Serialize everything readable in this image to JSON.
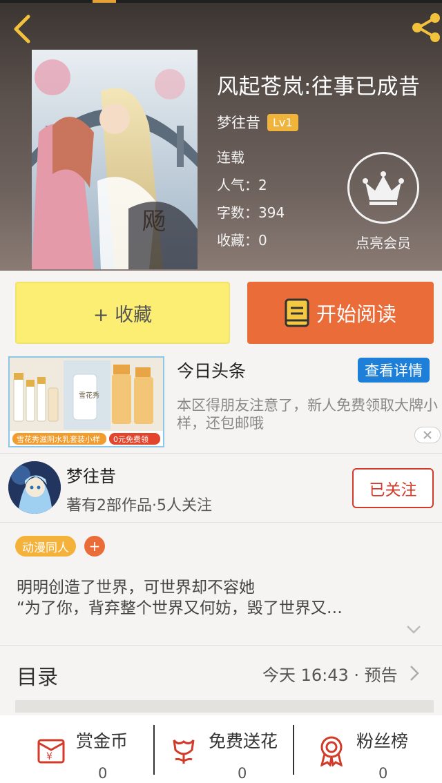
{
  "header": {
    "title": "风起苍岚:往事已成昔",
    "author": "梦往昔",
    "level": "Lv1",
    "status": "连载",
    "popularity": "人气：2",
    "word_count": "字数：394",
    "favorites": "收藏：0",
    "vip_label": "点亮会员"
  },
  "actions": {
    "collect_label": "+ 收藏",
    "read_label": "开始阅读"
  },
  "ad": {
    "title": "今日头条",
    "detail_button": "查看详情",
    "description": "本区得朋友注意了，新人免费领取大牌小样，还包邮哦",
    "banner_text": "雪花秀滋阴水乳套装小样",
    "banner_price": "0元免费领"
  },
  "writer": {
    "name": "梦往昔",
    "stats": "著有2部作品·5人关注",
    "follow_label": "已关注"
  },
  "tags": {
    "items": [
      "动漫同人"
    ],
    "add_label": "+"
  },
  "synopsis": {
    "line1": "明明创造了世界，可世界却不容她",
    "line2": "“为了你，背弃整个世界又何妨，毁了世界又…"
  },
  "catalog": {
    "title": "目录",
    "update": "今天 16:43 · 预告"
  },
  "bottom_stats": [
    {
      "label": "赏金币",
      "value": "0"
    },
    {
      "label": "免费送花",
      "value": "0"
    },
    {
      "label": "粉丝榜",
      "value": "0"
    }
  ],
  "colors": {
    "accent_orange": "#ea6c39",
    "collect_yellow": "#fbee73",
    "follow_red": "#d23a2a",
    "tag_orange": "#f5b23a",
    "detail_blue": "#1d7fd8"
  }
}
